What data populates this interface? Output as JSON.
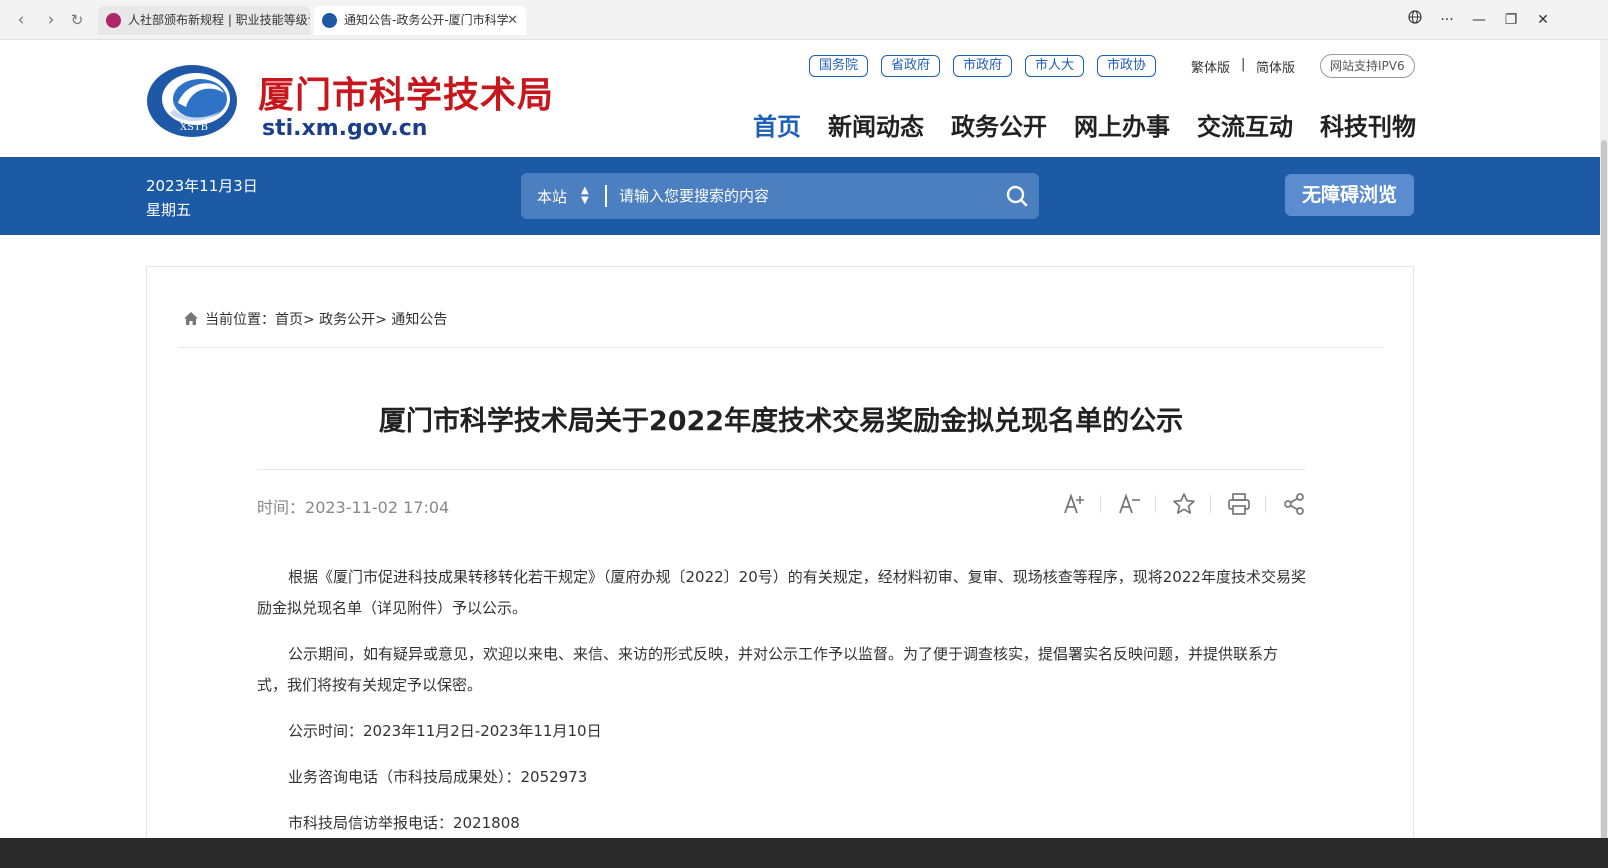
{
  "browser": {
    "tabs": [
      {
        "label": "人社部颁布新规程 | 职业技能等级认"
      },
      {
        "label": "通知公告-政务公开-厦门市科学"
      }
    ]
  },
  "header": {
    "site_title": "厦门市科学技术局",
    "logo_text": "XSTB",
    "domain": "sti.xm.gov.cn",
    "gov_links": [
      "国务院",
      "省政府",
      "市政府",
      "市人大",
      "市政协"
    ],
    "lang_traditional": "繁体版",
    "lang_separator": "|",
    "lang_simplified": "简体版",
    "ipv6": "网站支持IPV6",
    "nav": [
      "首页",
      "新闻动态",
      "政务公开",
      "网上办事",
      "交流互动",
      "科技刊物"
    ]
  },
  "band": {
    "date": "2023年11月3日",
    "weekday": "星期五",
    "search_scope": "本站",
    "search_placeholder": "请输入您要搜索的内容",
    "accessibility": "无障碍浏览"
  },
  "breadcrumb": {
    "label": "当前位置：",
    "path": "首页> 政务公开> 通知公告"
  },
  "article": {
    "title": "厦门市科学技术局关于2022年度技术交易奖励金拟兑现名单的公示",
    "time_label": "时间：",
    "time_value": "2023-11-02 17:04",
    "paragraphs": [
      "根据《厦门市促进科技成果转移转化若干规定》（厦府办规〔2022〕20号）的有关规定，经材料初审、复审、现场核查等程序，现将2022年度技术交易奖励金拟兑现名单（详见附件）予以公示。",
      "公示期间，如有疑异或意见，欢迎以来电、来信、来访的形式反映，并对公示工作予以监督。为了便于调查核实，提倡署实名反映问题，并提供联系方式，我们将按有关规定予以保密。",
      "公示时间：2023年11月2日-2023年11月10日",
      "业务咨询电话（市科技局成果处）：2052973",
      "市科技局信访举报电话：2021808"
    ]
  },
  "colors": {
    "brand_red": "#c8161d",
    "brand_blue": "#1d5aa6",
    "link_blue": "#1d5fb8"
  },
  "icons": [
    "back-icon",
    "forward-icon",
    "refresh-icon",
    "globe-icon",
    "more-icon",
    "minimize-icon",
    "restore-icon",
    "close-icon",
    "search-icon",
    "home-icon",
    "font-increase-icon",
    "font-decrease-icon",
    "star-icon",
    "print-icon",
    "share-icon"
  ]
}
